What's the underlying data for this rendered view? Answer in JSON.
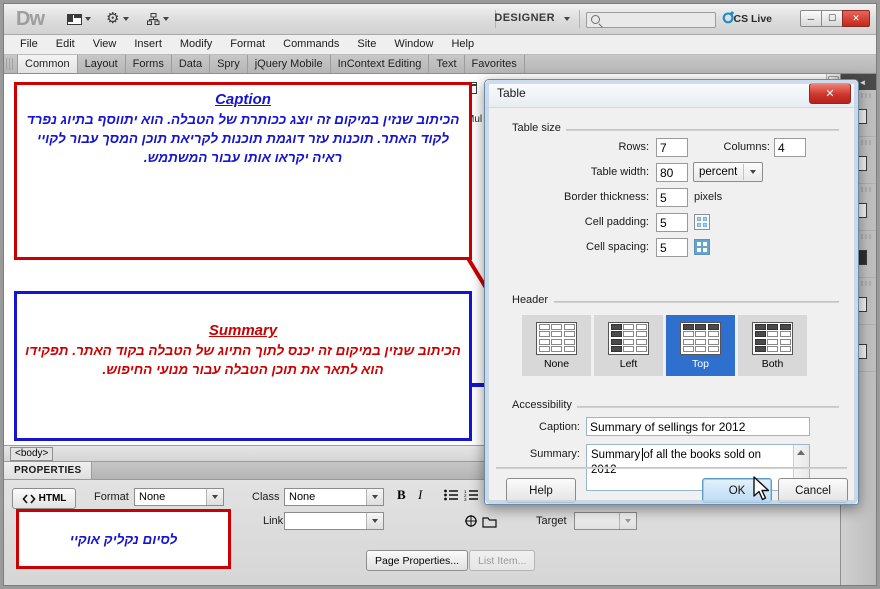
{
  "app": {
    "logo": "Dw",
    "workspace_label": "DESIGNER",
    "cs_live_label": "CS Live",
    "search_placeholder": ""
  },
  "menubar": {
    "items": [
      "File",
      "Edit",
      "View",
      "Insert",
      "Modify",
      "Format",
      "Commands",
      "Site",
      "Window",
      "Help"
    ]
  },
  "insert_tabs": {
    "items": [
      "Common",
      "Layout",
      "Forms",
      "Data",
      "Spry",
      "jQuery Mobile",
      "InContext Editing",
      "Text",
      "Favorites"
    ],
    "active": "Common"
  },
  "document": {
    "multiscreen_label": "Mul",
    "tag_selector": "<body>"
  },
  "properties": {
    "panel_title": "PROPERTIES",
    "html_button": "HTML",
    "format_label": "Format",
    "format_value": "None",
    "class_label": "Class",
    "class_value": "None",
    "link_label": "Link",
    "link_value": "",
    "target_label": "Target",
    "target_value": "",
    "bold_label": "B",
    "italic_label": "I",
    "page_properties_button": "Page Properties...",
    "list_item_button": "List Item..."
  },
  "dialog": {
    "title": "Table",
    "close_label": "✕",
    "groups": {
      "table_size": "Table size",
      "header": "Header",
      "accessibility": "Accessibility"
    },
    "fields": {
      "rows_label": "Rows:",
      "rows_value": "7",
      "columns_label": "Columns:",
      "columns_value": "4",
      "table_width_label": "Table width:",
      "table_width_value": "80",
      "table_width_unit": "percent",
      "border_thickness_label": "Border thickness:",
      "border_thickness_value": "5",
      "border_thickness_unit": "pixels",
      "cell_padding_label": "Cell padding:",
      "cell_padding_value": "5",
      "cell_spacing_label": "Cell spacing:",
      "cell_spacing_value": "5",
      "caption_label": "Caption:",
      "caption_value": "Summary of sellings for 2012",
      "summary_label": "Summary:",
      "summary_value": "Summary of all the books sold on 2012"
    },
    "header_options": [
      {
        "label": "None",
        "selected": false
      },
      {
        "label": "Left",
        "selected": false
      },
      {
        "label": "Top",
        "selected": true
      },
      {
        "label": "Both",
        "selected": false
      }
    ],
    "buttons": {
      "help": "Help",
      "ok": "OK",
      "cancel": "Cancel"
    }
  },
  "annotations": {
    "caption_box": {
      "title": "Caption",
      "body": "הכיתוב שנזין במיקום זה יוצג ככותרת של הטבלה. הוא יתווסף בתיוג נפרד לקוד האתר. תוכנות עזר דוגמת תוכנות לקריאת תוכן המסך עבור לקויי ראיה יקראו אותו עבור המשתמש.",
      "border_color": "#cc0000",
      "text_color": "#1414d2"
    },
    "summary_box": {
      "title": "Summary",
      "body": "הכיתוב שנזין במיקום זה יכנס לתוך התיוג של הטבלה בקוד האתר. תפקידו הוא לתאר את תוכן הטבלה עבור מנועי החיפוש.",
      "border_color": "#1414d2",
      "text_color": "#cc0000"
    },
    "finish_box": {
      "text": "לסיום נקליק אוקיי",
      "border_color": "#cc0000",
      "text_color": "#1414d2"
    }
  }
}
